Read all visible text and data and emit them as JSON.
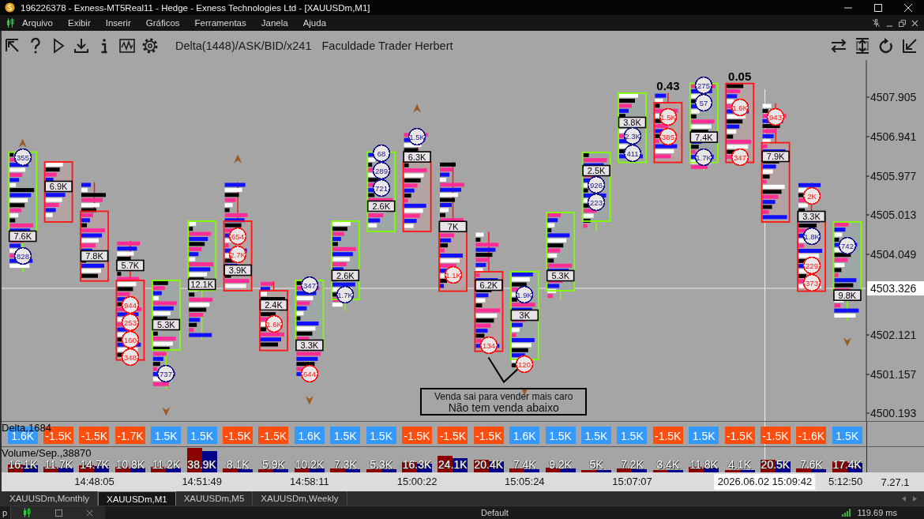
{
  "window": {
    "title": "196226378 - Exness-MT5Real11 - Hedge - Exness Technologies Ltd - [XAUUSDm,M1]"
  },
  "menu": {
    "items": [
      "Arquivo",
      "Exibir",
      "Inserir",
      "Gráficos",
      "Ferramentas",
      "Janela",
      "Ajuda"
    ]
  },
  "toolbar": {
    "indicator": "Delta(1448)/ASK/BID/x241",
    "caption": "Faculdade Trader Herbert"
  },
  "chart": {
    "yticks": [
      "4507.905",
      "4506.941",
      "4505.977",
      "4505.013",
      "4504.049",
      "4502.121",
      "4501.157",
      "4500.193"
    ],
    "price_line": {
      "label": "4503.326"
    },
    "crosshair": {
      "label": "2026.06.02 15:09:42"
    },
    "xticks": [
      "14:48:05",
      "14:51:49",
      "14:58:11",
      "15:00:22",
      "15:05:24",
      "15:07:07",
      "5:12:50"
    ],
    "corner_label": "7.27.1",
    "candles": [
      {
        "kind": "up",
        "label": "7.6K",
        "circles": [
          {
            "text": "355",
            "color": "#1a1a8c"
          },
          {
            "text": "828",
            "color": "#1a1a8c"
          }
        ],
        "arrow": {
          "kind": "up"
        }
      },
      {
        "kind": "down",
        "label": "6.9K"
      },
      {
        "kind": "down",
        "label": "7.8K"
      },
      {
        "kind": "down",
        "label": "5.7K",
        "circles": [
          {
            "text": "944",
            "color": "#ff1414"
          },
          {
            "text": "253",
            "color": "#ff1414"
          },
          {
            "text": "160",
            "color": "#ff1414"
          },
          {
            "text": "348",
            "color": "#ff1414"
          }
        ]
      },
      {
        "kind": "up",
        "label": "5.3K",
        "circles": [
          {
            "text": "737",
            "color": "#1a1a8c"
          }
        ],
        "arrow": {
          "kind": "down"
        }
      },
      {
        "kind": "up",
        "label": "12.1K"
      },
      {
        "kind": "down",
        "label": "3.9K",
        "circles": [
          {
            "text": "654",
            "color": "#ff1414"
          },
          {
            "text": "2.7K",
            "color": "#ff1414"
          }
        ],
        "arrow": {
          "kind": "up"
        }
      },
      {
        "kind": "down",
        "label": "2.4K",
        "circles": [
          {
            "text": "1.6K",
            "color": "#ff1414"
          }
        ]
      },
      {
        "kind": "up",
        "label": "3.3K",
        "circles": [
          {
            "text": "347",
            "color": "#1a1a8c"
          },
          {
            "text": "644",
            "color": "#ff1414"
          }
        ],
        "arrow": {
          "kind": "down"
        }
      },
      {
        "kind": "up",
        "label": "2.6K",
        "circles": [
          {
            "text": "1.7K",
            "color": "#1a1a8c"
          }
        ]
      },
      {
        "kind": "up",
        "label": "2.6K",
        "circles": [
          {
            "text": "68",
            "color": "#1a1a8c"
          },
          {
            "text": "289",
            "color": "#1a1a8c"
          },
          {
            "text": "721",
            "color": "#1a1a8c"
          }
        ]
      },
      {
        "kind": "down",
        "label": "6.3K",
        "circles": [
          {
            "text": "1.5K",
            "color": "#1a1a8c"
          }
        ],
        "arrow": {
          "kind": "up"
        }
      },
      {
        "kind": "down",
        "label": "7K",
        "circles": [
          {
            "text": "1.1K",
            "color": "#ff1414"
          }
        ]
      },
      {
        "kind": "down",
        "label": "6.2K",
        "circles": [
          {
            "text": "134",
            "color": "#ff1414"
          }
        ]
      },
      {
        "kind": "up",
        "label": "3K",
        "circles": [
          {
            "text": "1.9K",
            "color": "#1a1a8c"
          },
          {
            "text": "120",
            "color": "#ff1414"
          }
        ],
        "arrow": {
          "kind": "down"
        }
      },
      {
        "kind": "up",
        "label": "5.3K"
      },
      {
        "kind": "up",
        "label": "2.5K",
        "circles": [
          {
            "text": "926",
            "color": "#1a1a8c"
          },
          {
            "text": "223",
            "color": "#1a1a8c"
          }
        ]
      },
      {
        "kind": "up",
        "label": "3.8K",
        "circles": [
          {
            "text": "2.3K",
            "color": "#1a1a8c"
          },
          {
            "text": "411",
            "color": "#1a1a8c"
          }
        ]
      },
      {
        "kind": "down",
        "circles": [
          {
            "text": "1.5K",
            "color": "#ff1414"
          },
          {
            "text": "385",
            "color": "#ff1414"
          }
        ],
        "note": "0.43"
      },
      {
        "kind": "up",
        "label": "7.4K",
        "circles": [
          {
            "text": "275",
            "color": "#1a1a8c"
          },
          {
            "text": "57",
            "color": "#1a1a8c"
          },
          {
            "text": "1.7K",
            "color": "#1a1a8c"
          }
        ]
      },
      {
        "kind": "down",
        "circles": [
          {
            "text": "1.6K",
            "color": "#ff1414"
          },
          {
            "text": "347",
            "color": "#ff1414"
          }
        ],
        "note": "0.05"
      },
      {
        "kind": "down",
        "label": "7.9K",
        "circles": [
          {
            "text": "943",
            "color": "#ff1414"
          }
        ]
      },
      {
        "kind": "down",
        "label": "3.3K",
        "circles": [
          {
            "text": "2K",
            "color": "#ff1414"
          },
          {
            "text": "1.8K",
            "color": "#1a1a8c"
          },
          {
            "text": "229",
            "color": "#ff1414"
          },
          {
            "text": "373",
            "color": "#ff1414"
          }
        ]
      },
      {
        "kind": "up",
        "label": "9.8K",
        "circles": [
          {
            "text": "742",
            "color": "#1a1a8c"
          }
        ],
        "arrow": {
          "kind": "down"
        }
      }
    ],
    "text_box": {
      "lines": [
        "Venda sai para vender mais caro",
        "Não tem venda abaixo"
      ]
    }
  },
  "delta_panel": {
    "title": "Delta,1684",
    "cells": [
      {
        "text": "1.6K",
        "color": "#3399ff"
      },
      {
        "text": "-1.5K",
        "color": "#ff4d0d"
      },
      {
        "text": "-1.5K",
        "color": "#ff4d0d"
      },
      {
        "text": "-1.7K",
        "color": "#ff4d0d"
      },
      {
        "text": "1.5K",
        "color": "#3399ff"
      },
      {
        "text": "1.5K",
        "color": "#3399ff"
      },
      {
        "text": "-1.5K",
        "color": "#ff4d0d"
      },
      {
        "text": "-1.5K",
        "color": "#ff4d0d"
      },
      {
        "text": "1.6K",
        "color": "#3399ff"
      },
      {
        "text": "1.5K",
        "color": "#3399ff"
      },
      {
        "text": "1.5K",
        "color": "#3399ff"
      },
      {
        "text": "-1.5K",
        "color": "#ff4d0d"
      },
      {
        "text": "-1.5K",
        "color": "#ff4d0d"
      },
      {
        "text": "-1.5K",
        "color": "#ff4d0d"
      },
      {
        "text": "1.6K",
        "color": "#3399ff"
      },
      {
        "text": "1.5K",
        "color": "#3399ff"
      },
      {
        "text": "1.5K",
        "color": "#3399ff"
      },
      {
        "text": "1.5K",
        "color": "#3399ff"
      },
      {
        "text": "-1.5K",
        "color": "#ff4d0d"
      },
      {
        "text": "1.5K",
        "color": "#3399ff"
      },
      {
        "text": "-1.5K",
        "color": "#ff4d0d"
      },
      {
        "text": "-1.5K",
        "color": "#ff4d0d"
      },
      {
        "text": "-1.6K",
        "color": "#ff4d0d"
      },
      {
        "text": "1.5K",
        "color": "#3399ff"
      }
    ]
  },
  "volume_panel": {
    "title": "Volume/Sep.,38870",
    "cells": [
      "16.1K",
      "11.7K",
      "14.7K",
      "10.8K",
      "11.2K",
      "38.9K",
      "8.1K",
      "5.9K",
      "10.2K",
      "7.3K",
      "5.3K",
      "16.3K",
      "24.1K",
      "20.4K",
      "7.4K",
      "9.2K",
      "5K",
      "7.2K",
      "3.4K",
      "11.8K",
      "4.1K",
      "20.5K",
      "7.6K",
      "17.4K"
    ]
  },
  "tabs": [
    {
      "label": "XAUUSDm,Monthly",
      "selected": false
    },
    {
      "label": "XAUUSDm,M1",
      "selected": true
    },
    {
      "label": "XAUUSDm,M5",
      "selected": false
    },
    {
      "label": "XAUUSDm,Weekly",
      "selected": false
    }
  ],
  "status_bar": {
    "left_text": "p",
    "profile": "Default",
    "ping": "119.69 ms"
  }
}
